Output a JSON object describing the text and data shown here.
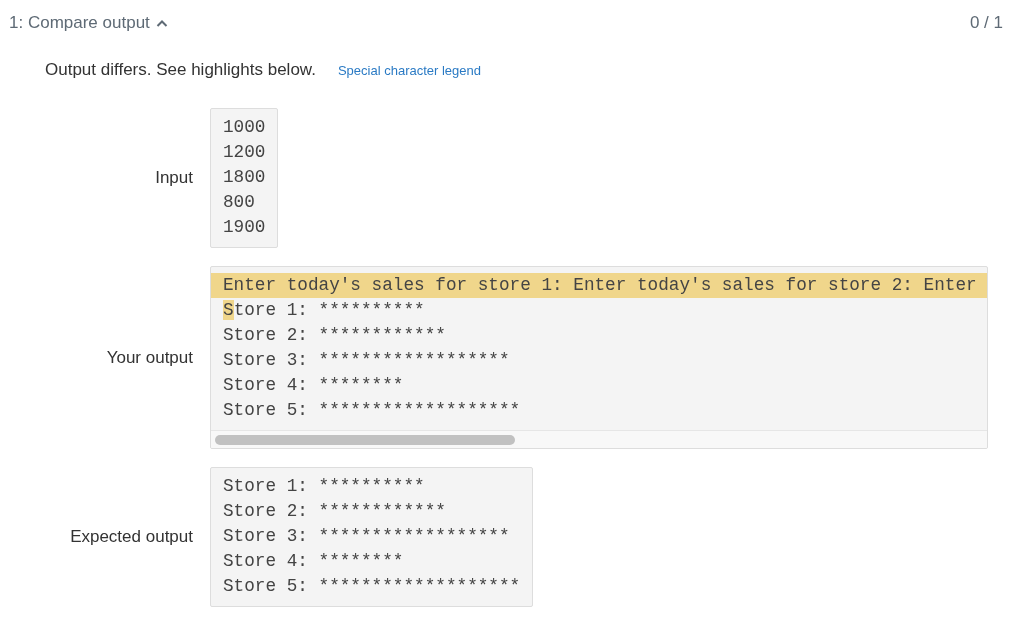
{
  "header": {
    "title": "1: Compare output",
    "expanded": true,
    "score": "0 / 1"
  },
  "message": {
    "text": "Output differs. See highlights below.",
    "link": "Special character legend"
  },
  "sections": [
    {
      "label": "Input",
      "scrollable": false,
      "lines": [
        [
          {
            "text": "1000",
            "highlighted": false
          }
        ],
        [
          {
            "text": "1200",
            "highlighted": false
          }
        ],
        [
          {
            "text": "1800",
            "highlighted": false
          }
        ],
        [
          {
            "text": "800",
            "highlighted": false
          }
        ],
        [
          {
            "text": "1900",
            "highlighted": false
          }
        ]
      ]
    },
    {
      "label": "Your output",
      "scrollable": true,
      "lines": [
        [
          {
            "text": "Enter today's sales for store 1: Enter today's sales for store 2: Enter",
            "highlighted": true
          }
        ],
        [
          {
            "text": "S",
            "highlighted": true
          },
          {
            "text": "tore 1: **********",
            "highlighted": false
          }
        ],
        [
          {
            "text": "Store 2: ************",
            "highlighted": false
          }
        ],
        [
          {
            "text": "Store 3: ******************",
            "highlighted": false
          }
        ],
        [
          {
            "text": "Store 4: ********",
            "highlighted": false
          }
        ],
        [
          {
            "text": "Store 5: *******************",
            "highlighted": false
          }
        ]
      ]
    },
    {
      "label": "Expected output",
      "scrollable": false,
      "lines": [
        [
          {
            "text": "Store 1: **********",
            "highlighted": false
          }
        ],
        [
          {
            "text": "Store 2: ************",
            "highlighted": false
          }
        ],
        [
          {
            "text": "Store 3: ******************",
            "highlighted": false
          }
        ],
        [
          {
            "text": "Store 4: ********",
            "highlighted": false
          }
        ],
        [
          {
            "text": "Store 5: *******************",
            "highlighted": false
          }
        ]
      ]
    }
  ]
}
